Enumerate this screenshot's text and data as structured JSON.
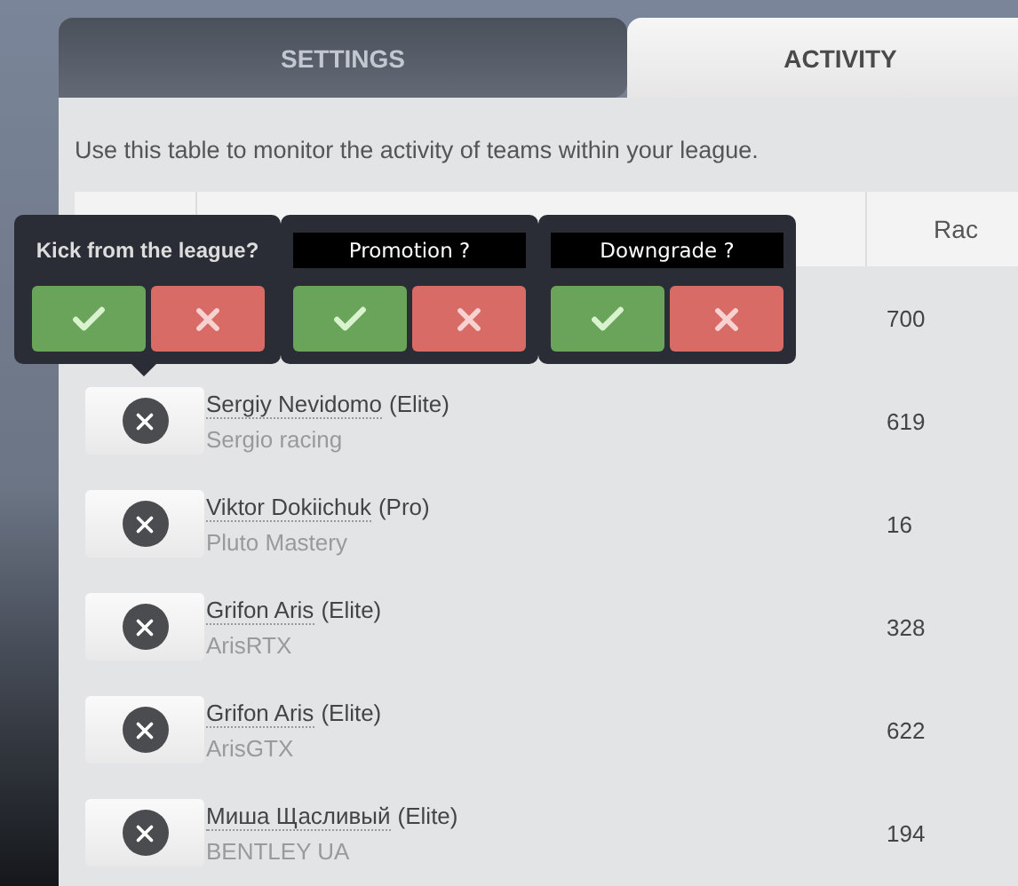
{
  "tabs": [
    {
      "label": "SETTINGS",
      "selected": false
    },
    {
      "label": "ACTIVITY",
      "selected": true
    }
  ],
  "description": "Use this table to monitor the activity of teams within your league.",
  "table": {
    "column_3_header": "Rac",
    "rows": [
      {
        "value": "700"
      },
      {
        "player": "Sergiy Nevidomo",
        "rank": "(Elite)",
        "team": "Sergio racing",
        "value": "619"
      },
      {
        "player": "Viktor Dokiichuk",
        "rank": "(Pro)",
        "team": "Pluto Mastery",
        "value": "16"
      },
      {
        "player": "Grifon Aris",
        "rank": "(Elite)",
        "team": "ArisRTX",
        "value": "328"
      },
      {
        "player": "Grifon Aris",
        "rank": "(Elite)",
        "team": "ArisGTX",
        "value": "622"
      },
      {
        "player": "Миша Щасливый",
        "rank": "(Elite)",
        "team": "BENTLEY UA",
        "value": "194"
      }
    ]
  },
  "confirm_popovers": [
    {
      "question": "Kick from the league?",
      "kind": "plain"
    },
    {
      "question": "Promotion ?",
      "kind": "boxed"
    },
    {
      "question": "Downgrade ?",
      "kind": "boxed"
    }
  ]
}
